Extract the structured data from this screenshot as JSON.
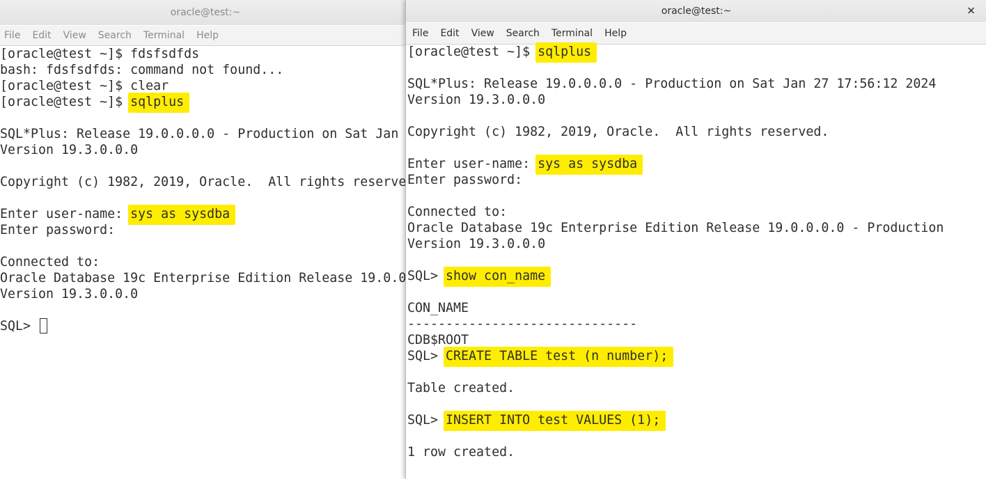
{
  "left_window": {
    "title": "oracle@test:~",
    "menu": [
      "File",
      "Edit",
      "View",
      "Search",
      "Terminal",
      "Help"
    ],
    "lines": [
      {
        "text": "[oracle@test ~]$ fdsfsdfds",
        "prefix": "",
        "hl": ""
      },
      {
        "text": "bash: fdsfsdfds: command not found...",
        "prefix": "",
        "hl": ""
      },
      {
        "text": "[oracle@test ~]$ clear",
        "prefix": "",
        "hl": ""
      },
      {
        "text": "",
        "prefix": "[oracle@test ~]$ ",
        "hl": "sqlplus"
      },
      {
        "text": "",
        "prefix": "",
        "hl": ""
      },
      {
        "text": "SQL*Plus: Release 19.0.0.0.0 - Production on Sat Jan",
        "prefix": "",
        "hl": ""
      },
      {
        "text": "Version 19.3.0.0.0",
        "prefix": "",
        "hl": ""
      },
      {
        "text": "",
        "prefix": "",
        "hl": ""
      },
      {
        "text": "Copyright (c) 1982, 2019, Oracle.  All rights reserve",
        "prefix": "",
        "hl": ""
      },
      {
        "text": "",
        "prefix": "",
        "hl": ""
      },
      {
        "text": "",
        "prefix": "Enter user-name: ",
        "hl": "sys as sysdba"
      },
      {
        "text": "Enter password:",
        "prefix": "",
        "hl": ""
      },
      {
        "text": "",
        "prefix": "",
        "hl": ""
      },
      {
        "text": "Connected to:",
        "prefix": "",
        "hl": ""
      },
      {
        "text": "Oracle Database 19c Enterprise Edition Release 19.0.0",
        "prefix": "",
        "hl": ""
      },
      {
        "text": "Version 19.3.0.0.0",
        "prefix": "",
        "hl": ""
      },
      {
        "text": "",
        "prefix": "",
        "hl": ""
      },
      {
        "text": "SQL> ",
        "prefix": "",
        "hl": "",
        "cursor": true
      }
    ]
  },
  "right_window": {
    "title": "oracle@test:~",
    "close_glyph": "✕",
    "menu": [
      "File",
      "Edit",
      "View",
      "Search",
      "Terminal",
      "Help"
    ],
    "lines": [
      {
        "text": "",
        "prefix": "[oracle@test ~]$ ",
        "hl": "sqlplus"
      },
      {
        "text": "",
        "prefix": "",
        "hl": ""
      },
      {
        "text": "SQL*Plus: Release 19.0.0.0.0 - Production on Sat Jan 27 17:56:12 2024",
        "prefix": "",
        "hl": ""
      },
      {
        "text": "Version 19.3.0.0.0",
        "prefix": "",
        "hl": ""
      },
      {
        "text": "",
        "prefix": "",
        "hl": ""
      },
      {
        "text": "Copyright (c) 1982, 2019, Oracle.  All rights reserved.",
        "prefix": "",
        "hl": ""
      },
      {
        "text": "",
        "prefix": "",
        "hl": ""
      },
      {
        "text": "",
        "prefix": "Enter user-name: ",
        "hl": "sys as sysdba"
      },
      {
        "text": "Enter password:",
        "prefix": "",
        "hl": ""
      },
      {
        "text": "",
        "prefix": "",
        "hl": ""
      },
      {
        "text": "Connected to:",
        "prefix": "",
        "hl": ""
      },
      {
        "text": "Oracle Database 19c Enterprise Edition Release 19.0.0.0.0 - Production",
        "prefix": "",
        "hl": ""
      },
      {
        "text": "Version 19.3.0.0.0",
        "prefix": "",
        "hl": ""
      },
      {
        "text": "",
        "prefix": "",
        "hl": ""
      },
      {
        "text": "",
        "prefix": "SQL> ",
        "hl": "show con_name"
      },
      {
        "text": "",
        "prefix": "",
        "hl": ""
      },
      {
        "text": "CON_NAME",
        "prefix": "",
        "hl": ""
      },
      {
        "text": "------------------------------",
        "prefix": "",
        "hl": ""
      },
      {
        "text": "CDB$ROOT",
        "prefix": "",
        "hl": ""
      },
      {
        "text": "",
        "prefix": "SQL> ",
        "hl": "CREATE TABLE test (n number);"
      },
      {
        "text": "",
        "prefix": "",
        "hl": ""
      },
      {
        "text": "Table created.",
        "prefix": "",
        "hl": ""
      },
      {
        "text": "",
        "prefix": "",
        "hl": ""
      },
      {
        "text": "",
        "prefix": "SQL> ",
        "hl": "INSERT INTO test VALUES (1);"
      },
      {
        "text": "",
        "prefix": "",
        "hl": ""
      },
      {
        "text": "1 row created.",
        "prefix": "",
        "hl": ""
      }
    ]
  },
  "colors": {
    "highlight": "#ffed00",
    "terminal_text": "#2e2e2e",
    "inactive_text": "#8a8a8a"
  }
}
